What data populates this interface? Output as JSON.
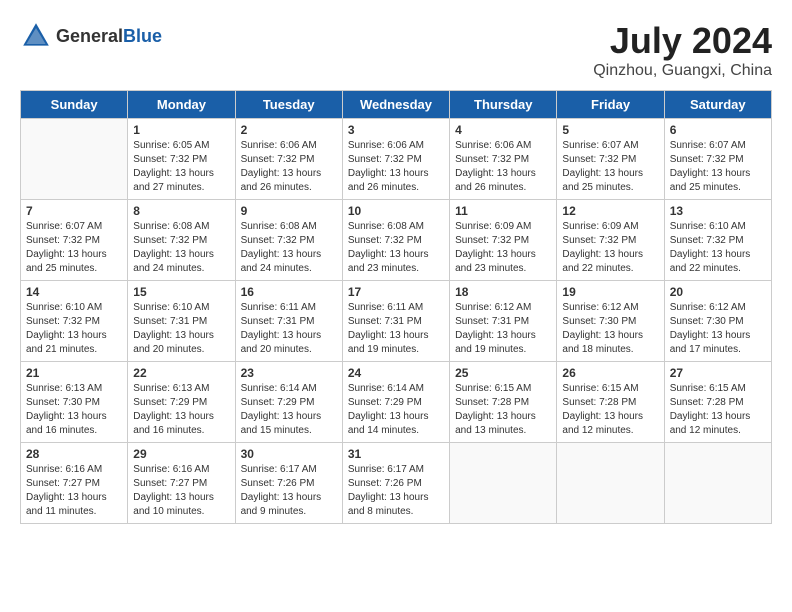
{
  "header": {
    "logo_general": "General",
    "logo_blue": "Blue",
    "month_title": "July 2024",
    "location": "Qinzhou, Guangxi, China"
  },
  "days_of_week": [
    "Sunday",
    "Monday",
    "Tuesday",
    "Wednesday",
    "Thursday",
    "Friday",
    "Saturday"
  ],
  "weeks": [
    [
      {
        "day": "",
        "sunrise": "",
        "sunset": "",
        "daylight": ""
      },
      {
        "day": "1",
        "sunrise": "Sunrise: 6:05 AM",
        "sunset": "Sunset: 7:32 PM",
        "daylight": "Daylight: 13 hours and 27 minutes."
      },
      {
        "day": "2",
        "sunrise": "Sunrise: 6:06 AM",
        "sunset": "Sunset: 7:32 PM",
        "daylight": "Daylight: 13 hours and 26 minutes."
      },
      {
        "day": "3",
        "sunrise": "Sunrise: 6:06 AM",
        "sunset": "Sunset: 7:32 PM",
        "daylight": "Daylight: 13 hours and 26 minutes."
      },
      {
        "day": "4",
        "sunrise": "Sunrise: 6:06 AM",
        "sunset": "Sunset: 7:32 PM",
        "daylight": "Daylight: 13 hours and 26 minutes."
      },
      {
        "day": "5",
        "sunrise": "Sunrise: 6:07 AM",
        "sunset": "Sunset: 7:32 PM",
        "daylight": "Daylight: 13 hours and 25 minutes."
      },
      {
        "day": "6",
        "sunrise": "Sunrise: 6:07 AM",
        "sunset": "Sunset: 7:32 PM",
        "daylight": "Daylight: 13 hours and 25 minutes."
      }
    ],
    [
      {
        "day": "7",
        "sunrise": "Sunrise: 6:07 AM",
        "sunset": "Sunset: 7:32 PM",
        "daylight": "Daylight: 13 hours and 25 minutes."
      },
      {
        "day": "8",
        "sunrise": "Sunrise: 6:08 AM",
        "sunset": "Sunset: 7:32 PM",
        "daylight": "Daylight: 13 hours and 24 minutes."
      },
      {
        "day": "9",
        "sunrise": "Sunrise: 6:08 AM",
        "sunset": "Sunset: 7:32 PM",
        "daylight": "Daylight: 13 hours and 24 minutes."
      },
      {
        "day": "10",
        "sunrise": "Sunrise: 6:08 AM",
        "sunset": "Sunset: 7:32 PM",
        "daylight": "Daylight: 13 hours and 23 minutes."
      },
      {
        "day": "11",
        "sunrise": "Sunrise: 6:09 AM",
        "sunset": "Sunset: 7:32 PM",
        "daylight": "Daylight: 13 hours and 23 minutes."
      },
      {
        "day": "12",
        "sunrise": "Sunrise: 6:09 AM",
        "sunset": "Sunset: 7:32 PM",
        "daylight": "Daylight: 13 hours and 22 minutes."
      },
      {
        "day": "13",
        "sunrise": "Sunrise: 6:10 AM",
        "sunset": "Sunset: 7:32 PM",
        "daylight": "Daylight: 13 hours and 22 minutes."
      }
    ],
    [
      {
        "day": "14",
        "sunrise": "Sunrise: 6:10 AM",
        "sunset": "Sunset: 7:32 PM",
        "daylight": "Daylight: 13 hours and 21 minutes."
      },
      {
        "day": "15",
        "sunrise": "Sunrise: 6:10 AM",
        "sunset": "Sunset: 7:31 PM",
        "daylight": "Daylight: 13 hours and 20 minutes."
      },
      {
        "day": "16",
        "sunrise": "Sunrise: 6:11 AM",
        "sunset": "Sunset: 7:31 PM",
        "daylight": "Daylight: 13 hours and 20 minutes."
      },
      {
        "day": "17",
        "sunrise": "Sunrise: 6:11 AM",
        "sunset": "Sunset: 7:31 PM",
        "daylight": "Daylight: 13 hours and 19 minutes."
      },
      {
        "day": "18",
        "sunrise": "Sunrise: 6:12 AM",
        "sunset": "Sunset: 7:31 PM",
        "daylight": "Daylight: 13 hours and 19 minutes."
      },
      {
        "day": "19",
        "sunrise": "Sunrise: 6:12 AM",
        "sunset": "Sunset: 7:30 PM",
        "daylight": "Daylight: 13 hours and 18 minutes."
      },
      {
        "day": "20",
        "sunrise": "Sunrise: 6:12 AM",
        "sunset": "Sunset: 7:30 PM",
        "daylight": "Daylight: 13 hours and 17 minutes."
      }
    ],
    [
      {
        "day": "21",
        "sunrise": "Sunrise: 6:13 AM",
        "sunset": "Sunset: 7:30 PM",
        "daylight": "Daylight: 13 hours and 16 minutes."
      },
      {
        "day": "22",
        "sunrise": "Sunrise: 6:13 AM",
        "sunset": "Sunset: 7:29 PM",
        "daylight": "Daylight: 13 hours and 16 minutes."
      },
      {
        "day": "23",
        "sunrise": "Sunrise: 6:14 AM",
        "sunset": "Sunset: 7:29 PM",
        "daylight": "Daylight: 13 hours and 15 minutes."
      },
      {
        "day": "24",
        "sunrise": "Sunrise: 6:14 AM",
        "sunset": "Sunset: 7:29 PM",
        "daylight": "Daylight: 13 hours and 14 minutes."
      },
      {
        "day": "25",
        "sunrise": "Sunrise: 6:15 AM",
        "sunset": "Sunset: 7:28 PM",
        "daylight": "Daylight: 13 hours and 13 minutes."
      },
      {
        "day": "26",
        "sunrise": "Sunrise: 6:15 AM",
        "sunset": "Sunset: 7:28 PM",
        "daylight": "Daylight: 13 hours and 12 minutes."
      },
      {
        "day": "27",
        "sunrise": "Sunrise: 6:15 AM",
        "sunset": "Sunset: 7:28 PM",
        "daylight": "Daylight: 13 hours and 12 minutes."
      }
    ],
    [
      {
        "day": "28",
        "sunrise": "Sunrise: 6:16 AM",
        "sunset": "Sunset: 7:27 PM",
        "daylight": "Daylight: 13 hours and 11 minutes."
      },
      {
        "day": "29",
        "sunrise": "Sunrise: 6:16 AM",
        "sunset": "Sunset: 7:27 PM",
        "daylight": "Daylight: 13 hours and 10 minutes."
      },
      {
        "day": "30",
        "sunrise": "Sunrise: 6:17 AM",
        "sunset": "Sunset: 7:26 PM",
        "daylight": "Daylight: 13 hours and 9 minutes."
      },
      {
        "day": "31",
        "sunrise": "Sunrise: 6:17 AM",
        "sunset": "Sunset: 7:26 PM",
        "daylight": "Daylight: 13 hours and 8 minutes."
      },
      {
        "day": "",
        "sunrise": "",
        "sunset": "",
        "daylight": ""
      },
      {
        "day": "",
        "sunrise": "",
        "sunset": "",
        "daylight": ""
      },
      {
        "day": "",
        "sunrise": "",
        "sunset": "",
        "daylight": ""
      }
    ]
  ]
}
